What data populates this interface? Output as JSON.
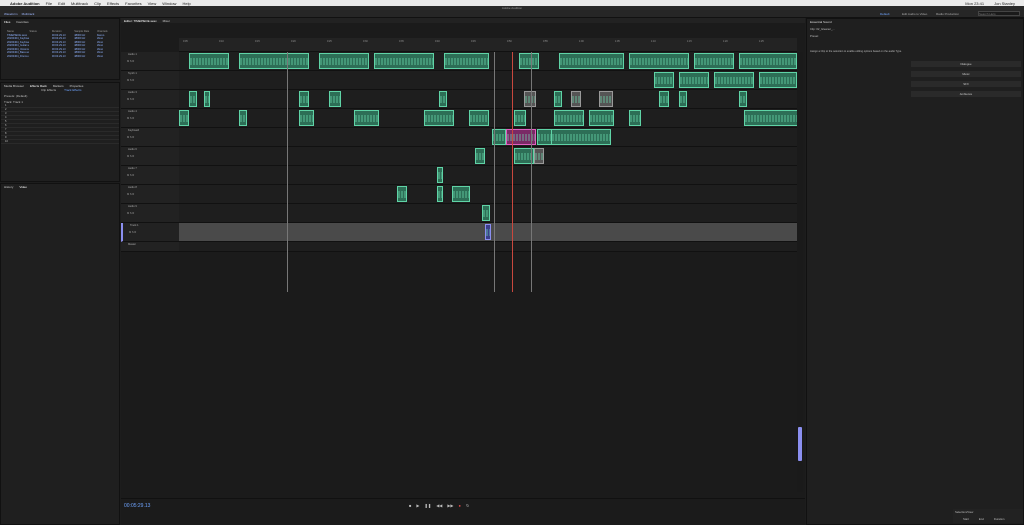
{
  "menubar": {
    "app": "Adobe Audition",
    "items": [
      "File",
      "Edit",
      "Multitrack",
      "Clip",
      "Effects",
      "Favorites",
      "View",
      "Window",
      "Help"
    ],
    "clock": "Mon 23:41",
    "user": "Jon Stanley"
  },
  "window": {
    "title": "Adobe Audition"
  },
  "toolbar": {
    "waveform_label": "Waveform",
    "multitrack_label": "Multitrack",
    "workspaces": [
      "Default",
      "Edit Audio to Video",
      "Radio Production"
    ],
    "search_placeholder": "Search Help"
  },
  "files_panel": {
    "tabs": [
      "Files",
      "Favorites"
    ],
    "columns": [
      "Name",
      "Status",
      "Duration",
      "Sample Rate",
      "Channels"
    ],
    "rows": [
      [
        "TIMEPIECE.sesx",
        "",
        "00:04:29.13",
        "48000 Hz",
        "Stereo"
      ],
      [
        "20200404_Keyboard.wav",
        "",
        "00:04:29.13",
        "48000 Hz",
        "Mono"
      ],
      [
        "20200404_Keyboard2.wav",
        "",
        "00:04:29.13",
        "48000 Hz",
        "Mono"
      ],
      [
        "20200404_Guitar.wav",
        "",
        "00:04:29.13",
        "48000 Hz",
        "Mono"
      ],
      [
        "20200404_Vocal.wav",
        "",
        "00:04:29.13",
        "48000 Hz",
        "Mono"
      ],
      [
        "20200404_Bass.wav",
        "",
        "00:04:29.13",
        "48000 Hz",
        "Mono"
      ],
      [
        "20200404_Drums.wav",
        "",
        "00:04:29.13",
        "48000 Hz",
        "Mono"
      ]
    ]
  },
  "effects_panel": {
    "tabs": [
      "Media Browser",
      "Effects Rack",
      "Markers",
      "Properties"
    ],
    "subtabs": [
      "Clip Effects",
      "Track Effects"
    ],
    "preset_label": "Presets:",
    "preset_value": "(Default)",
    "track_label": "Track: Track 1",
    "slots": [
      "1",
      "2",
      "3",
      "4",
      "5",
      "6",
      "7",
      "8",
      "9",
      "10"
    ]
  },
  "video_panel": {
    "tabs": [
      "History",
      "Video"
    ]
  },
  "editor": {
    "tabs": [
      "Editor: TIMEPIECE.sesx",
      "Mixer"
    ],
    "ruler_ticks": [
      "0:05",
      "0:10",
      "0:15",
      "0:20",
      "0:25",
      "0:30",
      "0:35",
      "0:40",
      "0:45",
      "0:50",
      "0:55",
      "1:00",
      "1:05",
      "1:10",
      "1:15",
      "1:20",
      "1:25"
    ],
    "tracks": [
      {
        "name": "Audio 1"
      },
      {
        "name": "Synth 1"
      },
      {
        "name": "Audio 3"
      },
      {
        "name": "Audio 4"
      },
      {
        "name": "Keyboard"
      },
      {
        "name": "Audio 6"
      },
      {
        "name": "Audio 7"
      },
      {
        "name": "Audio 8"
      },
      {
        "name": "Audio 9"
      },
      {
        "name": "Track 1"
      },
      {
        "name": "Master"
      }
    ],
    "timecode": "00:05:29.13"
  },
  "essential_sound": {
    "title": "Essential Sound",
    "clip_label": "Clip: 02_Gleaner_...",
    "help": "Assign a Clip to the selection to enable editing options based on the audio Type.",
    "types": [
      "Dialogue",
      "Music",
      "SFX",
      "Ambience"
    ],
    "preset_label": "Preset:"
  },
  "selection_view": {
    "title": "Selection/View",
    "columns": [
      "Start",
      "End",
      "Duration"
    ]
  }
}
